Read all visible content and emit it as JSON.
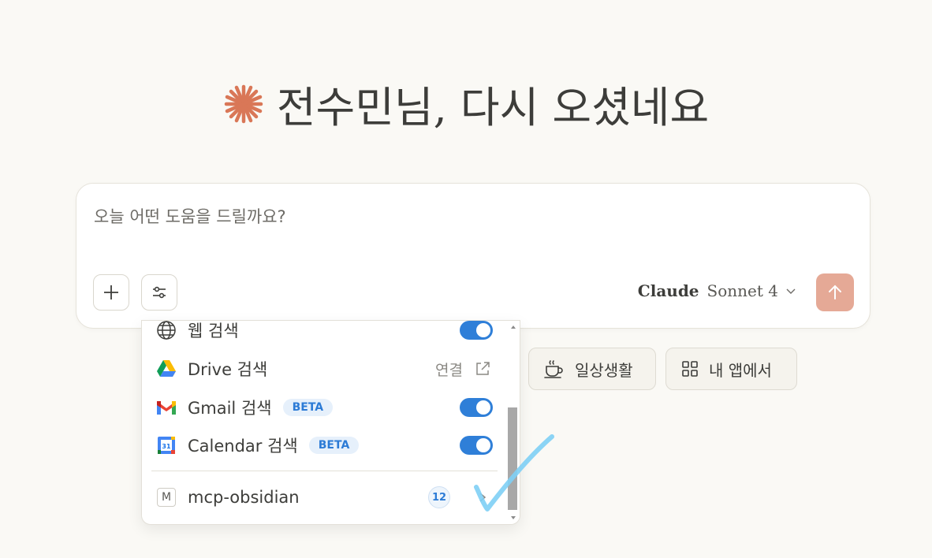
{
  "greeting": {
    "title": "전수민님, 다시 오셨네요"
  },
  "composer": {
    "placeholder": "오늘 어떤 도움을 드릴까요?",
    "model_brand": "Claude",
    "model_name": "Sonnet 4"
  },
  "chips": [
    {
      "label": "일상생활",
      "icon": "coffee-cup-icon"
    },
    {
      "label": "내 앱에서",
      "icon": "grid-icon"
    }
  ],
  "menu": {
    "items": [
      {
        "label": "웹 검색",
        "icon": "globe-icon",
        "enabled": true
      },
      {
        "label": "Drive 검색",
        "icon": "google-drive-icon",
        "action": "연결"
      },
      {
        "label": "Gmail 검색",
        "icon": "gmail-icon",
        "badge": "BETA",
        "enabled": true
      },
      {
        "label": "Calendar 검색",
        "icon": "google-calendar-icon",
        "calendar_day": "31",
        "badge": "BETA",
        "enabled": true
      }
    ],
    "server": {
      "label": "mcp-obsidian",
      "initial": "M",
      "count": "12"
    }
  },
  "colors": {
    "accent": "#d97757",
    "send": "#e5a996",
    "toggle": "#2f7fd8",
    "background": "#faf9f5",
    "annotation": "#7ecff5"
  }
}
